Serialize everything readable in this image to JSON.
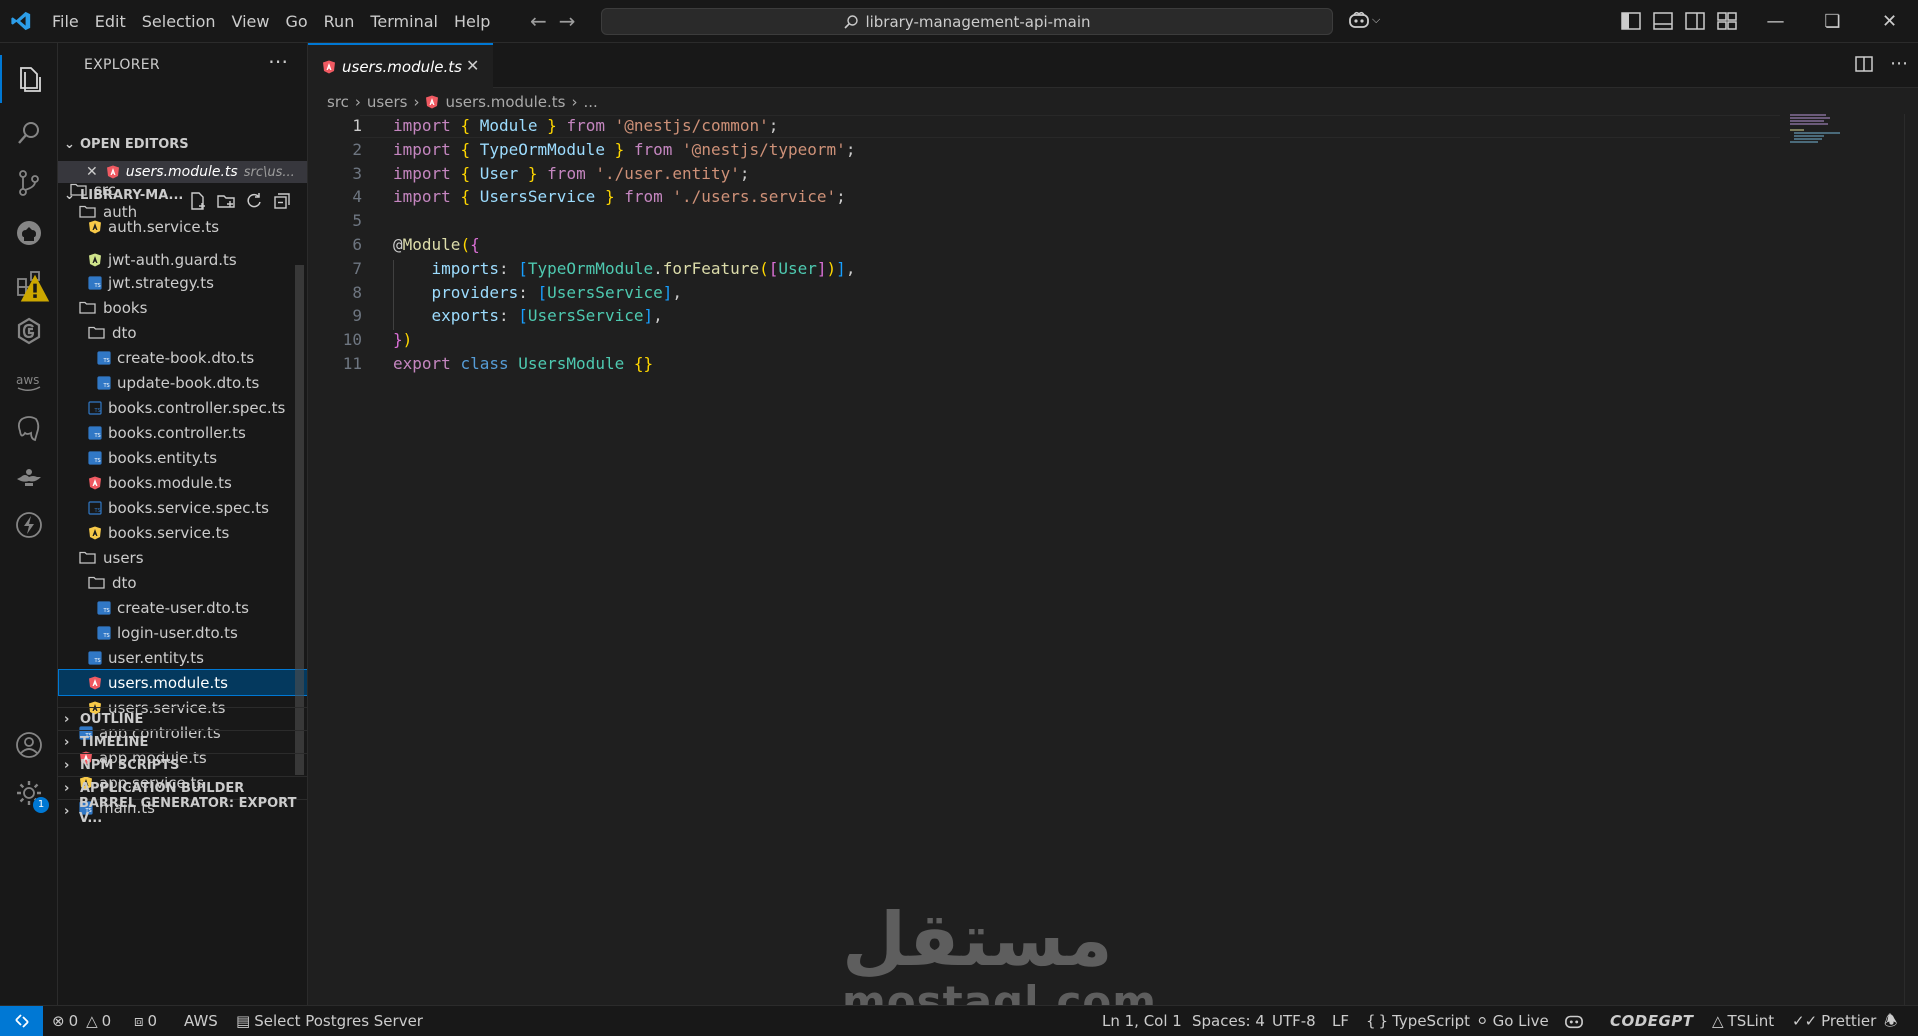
{
  "menu": [
    "File",
    "Edit",
    "Selection",
    "View",
    "Go",
    "Run",
    "Terminal",
    "Help"
  ],
  "search": {
    "text": "library-management-api-main"
  },
  "sidebar": {
    "title": "EXPLORER",
    "open_editors_header": "OPEN EDITORS",
    "open_editor": {
      "name": "users.module.ts",
      "path": "src\\us..."
    },
    "project_header": "LIBRARY-MA...",
    "tree": [
      {
        "label": "src",
        "kind": "folder-root"
      },
      {
        "label": "auth",
        "kind": "folder"
      },
      {
        "label": "auth.service.ts",
        "kind": "ts-service"
      },
      {
        "label": "jwt-auth.guard.ts",
        "kind": "ts-guard"
      },
      {
        "label": "jwt.strategy.ts",
        "kind": "ts"
      },
      {
        "label": "books",
        "kind": "folder"
      },
      {
        "label": "dto",
        "kind": "folder"
      },
      {
        "label": "create-book.dto.ts",
        "kind": "ts"
      },
      {
        "label": "update-book.dto.ts",
        "kind": "ts"
      },
      {
        "label": "books.controller.spec.ts",
        "kind": "ts-spec"
      },
      {
        "label": "books.controller.ts",
        "kind": "ts"
      },
      {
        "label": "books.entity.ts",
        "kind": "ts"
      },
      {
        "label": "books.module.ts",
        "kind": "angular"
      },
      {
        "label": "books.service.spec.ts",
        "kind": "ts-spec"
      },
      {
        "label": "books.service.ts",
        "kind": "ts-service"
      },
      {
        "label": "users",
        "kind": "folder"
      },
      {
        "label": "dto",
        "kind": "folder"
      },
      {
        "label": "create-user.dto.ts",
        "kind": "ts"
      },
      {
        "label": "login-user.dto.ts",
        "kind": "ts"
      },
      {
        "label": "user.entity.ts",
        "kind": "ts"
      },
      {
        "label": "users.module.ts",
        "kind": "angular"
      },
      {
        "label": "users.service.ts",
        "kind": "ts-service"
      },
      {
        "label": "app.controller.ts",
        "kind": "ts"
      },
      {
        "label": "app.module.ts",
        "kind": "angular"
      },
      {
        "label": "app.service.ts",
        "kind": "ts-service"
      },
      {
        "label": "main.ts",
        "kind": "ts"
      }
    ],
    "sections": [
      "OUTLINE",
      "TIMELINE",
      "NPM SCRIPTS",
      "APPLICATION BUILDER",
      "BARREL GENERATOR: EXPORT V..."
    ]
  },
  "editor": {
    "tab": "users.module.ts",
    "breadcrumb": [
      "src",
      "users",
      "users.module.ts",
      "..."
    ],
    "current_line": 1,
    "lines": [
      [
        [
          "kw",
          "import"
        ],
        [
          "pl",
          " "
        ],
        [
          "br1",
          "{"
        ],
        [
          "pl",
          " "
        ],
        [
          "id",
          "Module"
        ],
        [
          "pl",
          " "
        ],
        [
          "br1",
          "}"
        ],
        [
          "pl",
          " "
        ],
        [
          "kw",
          "from"
        ],
        [
          "pl",
          " "
        ],
        [
          "str",
          "'@nestjs/common'"
        ],
        [
          "pl",
          ";"
        ]
      ],
      [
        [
          "kw",
          "import"
        ],
        [
          "pl",
          " "
        ],
        [
          "br1",
          "{"
        ],
        [
          "pl",
          " "
        ],
        [
          "id",
          "TypeOrmModule"
        ],
        [
          "pl",
          " "
        ],
        [
          "br1",
          "}"
        ],
        [
          "pl",
          " "
        ],
        [
          "kw",
          "from"
        ],
        [
          "pl",
          " "
        ],
        [
          "str",
          "'@nestjs/typeorm'"
        ],
        [
          "pl",
          ";"
        ]
      ],
      [
        [
          "kw",
          "import"
        ],
        [
          "pl",
          " "
        ],
        [
          "br1",
          "{"
        ],
        [
          "pl",
          " "
        ],
        [
          "id",
          "User"
        ],
        [
          "pl",
          " "
        ],
        [
          "br1",
          "}"
        ],
        [
          "pl",
          " "
        ],
        [
          "kw",
          "from"
        ],
        [
          "pl",
          " "
        ],
        [
          "str",
          "'./user.entity'"
        ],
        [
          "pl",
          ";"
        ]
      ],
      [
        [
          "kw",
          "import"
        ],
        [
          "pl",
          " "
        ],
        [
          "br1",
          "{"
        ],
        [
          "pl",
          " "
        ],
        [
          "id",
          "UsersService"
        ],
        [
          "pl",
          " "
        ],
        [
          "br1",
          "}"
        ],
        [
          "pl",
          " "
        ],
        [
          "kw",
          "from"
        ],
        [
          "pl",
          " "
        ],
        [
          "str",
          "'./users.service'"
        ],
        [
          "pl",
          ";"
        ]
      ],
      [],
      [
        [
          "pl",
          "@"
        ],
        [
          "fn",
          "Module"
        ],
        [
          "br1",
          "("
        ],
        [
          "br2",
          "{"
        ]
      ],
      [
        [
          "pl",
          "    "
        ],
        [
          "id",
          "imports"
        ],
        [
          "pl",
          ": "
        ],
        [
          "br3",
          "["
        ],
        [
          "cls",
          "TypeOrmModule"
        ],
        [
          "pl",
          "."
        ],
        [
          "fn",
          "forFeature"
        ],
        [
          "br1",
          "("
        ],
        [
          "br2",
          "["
        ],
        [
          "cls",
          "User"
        ],
        [
          "br2",
          "]"
        ],
        [
          "br1",
          ")"
        ],
        [
          "br3",
          "]"
        ],
        [
          "pl",
          ","
        ]
      ],
      [
        [
          "pl",
          "    "
        ],
        [
          "id",
          "providers"
        ],
        [
          "pl",
          ": "
        ],
        [
          "br3",
          "["
        ],
        [
          "cls",
          "UsersService"
        ],
        [
          "br3",
          "]"
        ],
        [
          "pl",
          ","
        ]
      ],
      [
        [
          "pl",
          "    "
        ],
        [
          "id",
          "exports"
        ],
        [
          "pl",
          ": "
        ],
        [
          "br3",
          "["
        ],
        [
          "cls",
          "UsersService"
        ],
        [
          "br3",
          "]"
        ],
        [
          "pl",
          ","
        ]
      ],
      [
        [
          "br2",
          "}"
        ],
        [
          "br1",
          ")"
        ]
      ],
      [
        [
          "kw",
          "export"
        ],
        [
          "pl",
          " "
        ],
        [
          "kw2",
          "class"
        ],
        [
          "pl",
          " "
        ],
        [
          "cls",
          "UsersModule"
        ],
        [
          "pl",
          " "
        ],
        [
          "br1",
          "{}"
        ]
      ]
    ]
  },
  "watermark": {
    "arabic": "مستقل",
    "latin": "mostaql.com"
  },
  "status": {
    "errors": "0",
    "warnings": "0",
    "ports": "0",
    "aws": "AWS",
    "postgres": "Select Postgres Server",
    "position": "Ln 1, Col 1",
    "spaces": "Spaces: 4",
    "encoding": "UTF-8",
    "eol": "LF",
    "language": "TypeScript",
    "golive": "Go Live",
    "codegpt": "CODEGPT",
    "tslint": "TSLint",
    "prettier": "Prettier"
  },
  "badges": {
    "accounts_settings": "1"
  },
  "colors": {
    "accent": "#0078d4",
    "angular": "#f05a62",
    "ts": "#3178c6",
    "service": "#f7c948"
  }
}
